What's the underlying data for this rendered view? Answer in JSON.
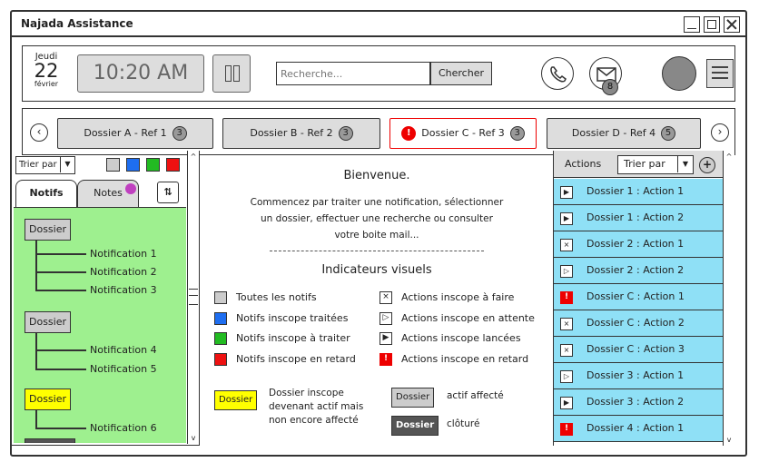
{
  "window": {
    "title": "Najada Assistance"
  },
  "header": {
    "day_name": "Jeudi",
    "day_number": "22",
    "month": "février",
    "time": "10:20 AM",
    "search_placeholder": "Recherche...",
    "search_button": "Chercher",
    "mail_count": "8"
  },
  "dossier_tabs": [
    {
      "label": "Dossier A - Ref 1",
      "count": "3",
      "alert": false
    },
    {
      "label": "Dossier B - Ref 2",
      "count": "3",
      "alert": false
    },
    {
      "label": "Dossier C - Ref 3",
      "count": "3",
      "alert": true,
      "alert_symbol": "!"
    },
    {
      "label": "Dossier D - Ref 4",
      "count": "5",
      "alert": false
    }
  ],
  "left_panel": {
    "sort_label": "Trier par",
    "tabs": {
      "notifs": "Notifs",
      "notes": "Notes"
    },
    "swatches": [
      "#cccccc",
      "#1e6ef0",
      "#22bb22",
      "#ee1111"
    ],
    "tree": [
      {
        "dossier": "Dossier",
        "style": "grey",
        "items": [
          "Notification 1",
          "Notification 2",
          "Notification 3"
        ]
      },
      {
        "dossier": "Dossier",
        "style": "grey",
        "items": [
          "Notification 4",
          "Notification 5"
        ]
      },
      {
        "dossier": "Dossier",
        "style": "yellow",
        "items": [
          "Notification 6"
        ]
      }
    ]
  },
  "center": {
    "welcome": "Bienvenue.",
    "intro_1": "Commencez par traiter une notification, sélectionner",
    "intro_2": "un dossier, effectuer une recherche ou consulter",
    "intro_3": "votre boite mail...",
    "indicators_title": "Indicateurs visuels",
    "legend_left": [
      {
        "label": "Toutes les notifs",
        "color": "#cccccc"
      },
      {
        "label": "Notifs inscope traitées",
        "color": "#1e6ef0"
      },
      {
        "label": "Notifs inscope à traiter",
        "color": "#22bb22"
      },
      {
        "label": "Notifs inscope en retard",
        "color": "#ee1111"
      }
    ],
    "legend_right": [
      {
        "label": "Actions inscope à faire",
        "icon": "×"
      },
      {
        "label": "Actions inscope en attente",
        "icon": "▷"
      },
      {
        "label": "Actions inscope lancées",
        "icon": "▶"
      },
      {
        "label": "Actions inscope en retard",
        "icon": "!"
      }
    ],
    "chip_yellow": "Dossier",
    "chip_yellow_desc_1": "Dossier inscope",
    "chip_yellow_desc_2": "devenant actif mais",
    "chip_yellow_desc_3": "non encore affecté",
    "chip_grey": "Dossier",
    "chip_grey_desc": "actif affecté",
    "chip_dark": "Dossier",
    "chip_dark_desc": "clôturé"
  },
  "right_panel": {
    "title": "Actions",
    "sort_label": "Trier par",
    "add_symbol": "+",
    "actions": [
      {
        "label": "Dossier 1 : Action 1",
        "icon": "▶"
      },
      {
        "label": "Dossier 1 : Action 2",
        "icon": "▶"
      },
      {
        "label": "Dossier 2 : Action 1",
        "icon": "×"
      },
      {
        "label": "Dossier 2 : Action 2",
        "icon": "▷"
      },
      {
        "label": "Dossier C : Action 1",
        "icon": "!"
      },
      {
        "label": "Dossier C : Action 2",
        "icon": "×"
      },
      {
        "label": "Dossier C : Action 3",
        "icon": "×"
      },
      {
        "label": "Dossier 3 : Action 1",
        "icon": "▷"
      },
      {
        "label": "Dossier 3 : Action 2",
        "icon": "▶"
      },
      {
        "label": "Dossier 4 : Action 1",
        "icon": "!"
      }
    ]
  }
}
